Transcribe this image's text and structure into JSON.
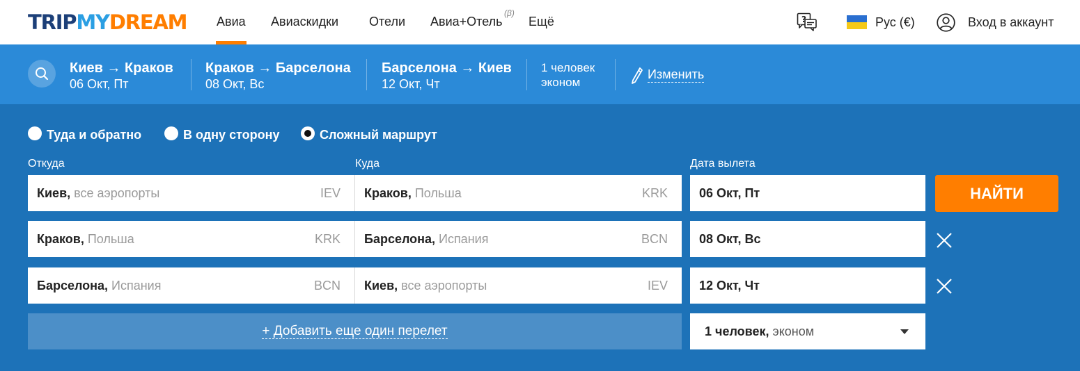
{
  "logo": {
    "part1": "TRIP",
    "part2": "MY",
    "part3": "DREAM"
  },
  "nav": {
    "items": [
      {
        "label": "Авиа"
      },
      {
        "label": "Авиаскидки"
      },
      {
        "label": "Отели"
      },
      {
        "label": "Авиа+Отель"
      },
      {
        "label": "Ещё"
      }
    ],
    "beta": "(β)",
    "active_index": 0
  },
  "header_right": {
    "language": "Рус (€)",
    "login": "Вход в аккаунт"
  },
  "summary": {
    "segments": [
      {
        "route": "Киев → Краков",
        "date": "06 Окт, Пт"
      },
      {
        "route": "Краков → Барселона",
        "date": "08 Окт, Вс"
      },
      {
        "route": "Барселона → Киев",
        "date": "12 Окт, Чт"
      }
    ],
    "passengers_line1": "1 человек",
    "passengers_line2": "эконом",
    "edit_label": "Изменить"
  },
  "trip_type": {
    "options": [
      {
        "label": "Туда и обратно",
        "selected": false
      },
      {
        "label": "В одну сторону",
        "selected": false
      },
      {
        "label": "Сложный маршрут",
        "selected": true
      }
    ]
  },
  "form": {
    "labels": {
      "from": "Откуда",
      "to": "Куда",
      "date": "Дата вылета"
    },
    "rows": [
      {
        "from_city": "Киев,",
        "from_detail": " все аэропорты",
        "from_code": "IEV",
        "to_city": "Краков,",
        "to_detail": " Польша",
        "to_code": "KRK",
        "date": "06 Окт, Пт"
      },
      {
        "from_city": "Краков,",
        "from_detail": " Польша",
        "from_code": "KRK",
        "to_city": "Барселона,",
        "to_detail": " Испания",
        "to_code": "BCN",
        "date": "08 Окт, Вс"
      },
      {
        "from_city": "Барселона,",
        "from_detail": " Испания",
        "from_code": "BCN",
        "to_city": "Киев,",
        "to_detail": " все аэропорты",
        "to_code": "IEV",
        "date": "12 Окт, Чт"
      }
    ],
    "search_button": "НАЙТИ",
    "add_flight": "+ Добавить еще один перелет",
    "passengers_count": "1 человек,",
    "passengers_class": " эконом"
  },
  "colors": {
    "accent": "#ff7e00",
    "summary_bg": "#2b8ad8",
    "form_bg": "#1d72b8",
    "logo_dark": "#1c3f78",
    "logo_light": "#2b9fe3"
  }
}
